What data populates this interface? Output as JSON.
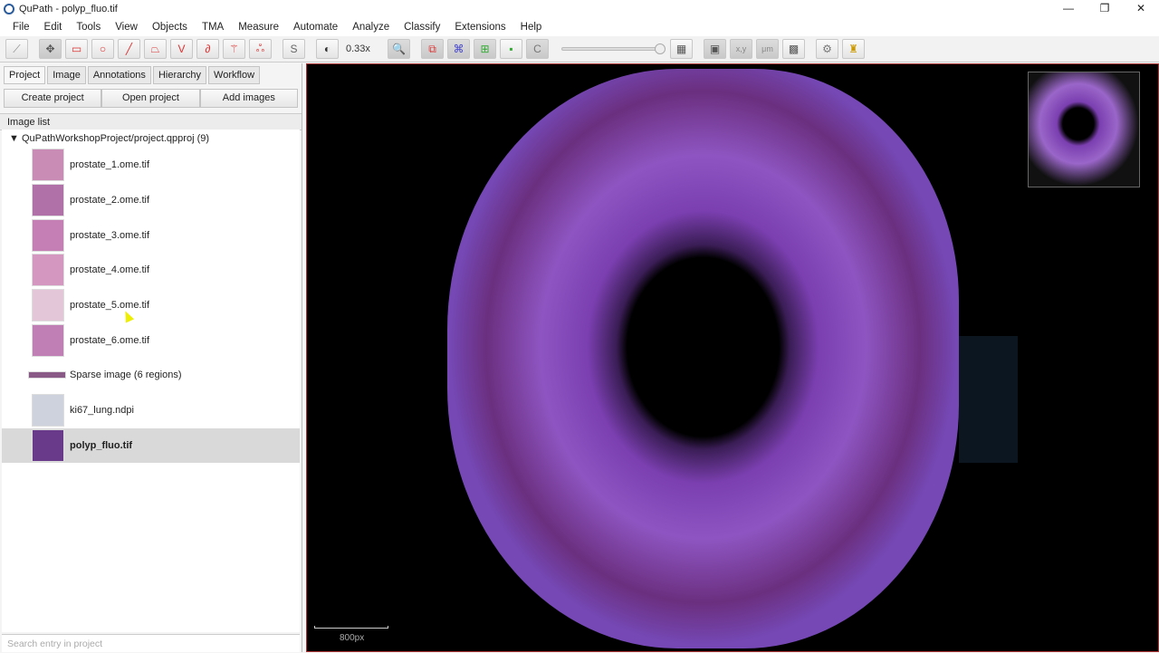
{
  "window": {
    "title": "QuPath - polyp_fluo.tif",
    "controls": [
      "—",
      "❐",
      "✕"
    ]
  },
  "menu": [
    "File",
    "Edit",
    "Tools",
    "View",
    "Objects",
    "TMA",
    "Measure",
    "Automate",
    "Analyze",
    "Classify",
    "Extensions",
    "Help"
  ],
  "toolbar": {
    "zoom": "0.33x",
    "tool_icons": [
      "measure-icon",
      "move-icon",
      "rectangle-icon",
      "ellipse-icon",
      "line-icon",
      "polygon-icon",
      "polyline-icon",
      "brush-icon",
      "wand-icon",
      "points-icon"
    ]
  },
  "left": {
    "tabs": [
      "Project",
      "Image",
      "Annotations",
      "Hierarchy",
      "Workflow"
    ],
    "buttons": [
      "Create project",
      "Open project",
      "Add images"
    ],
    "list_header": "Image list",
    "project": "QuPathWorkshopProject/project.qpproj (9)",
    "items": [
      {
        "name": "prostate_1.ome.tif",
        "thumb": "#c98db5"
      },
      {
        "name": "prostate_2.ome.tif",
        "thumb": "#b070a8"
      },
      {
        "name": "prostate_3.ome.tif",
        "thumb": "#c57fb4"
      },
      {
        "name": "prostate_4.ome.tif",
        "thumb": "#d497c0"
      },
      {
        "name": "prostate_5.ome.tif",
        "thumb": "#e3c7d8"
      },
      {
        "name": "prostate_6.ome.tif",
        "thumb": "#c07fb5"
      },
      {
        "name": "Sparse image (6 regions)",
        "thumb": "#8a5a86"
      },
      {
        "name": "ki67_lung.ndpi",
        "thumb": "#cdd2dc"
      },
      {
        "name": "polyp_fluo.tif",
        "thumb": "#6a3a8a"
      }
    ],
    "search_placeholder": "Search entry in project"
  },
  "viewer": {
    "scalebar": "800px"
  }
}
